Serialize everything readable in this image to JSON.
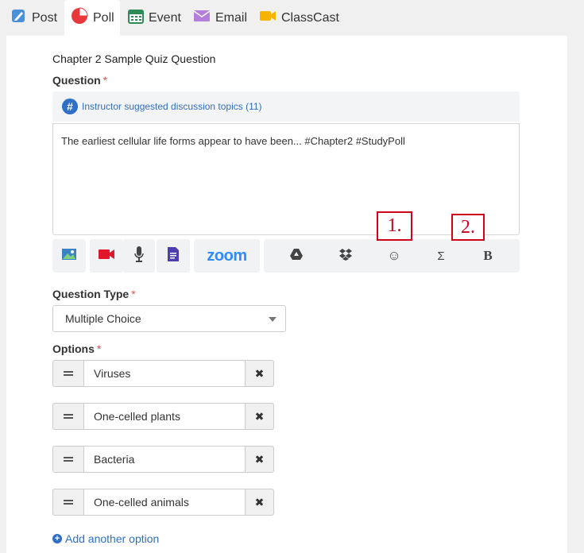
{
  "tabs": [
    {
      "label": "Post",
      "icon": "post-icon"
    },
    {
      "label": "Poll",
      "icon": "pie-chart-icon",
      "active": true
    },
    {
      "label": "Event",
      "icon": "calendar-icon"
    },
    {
      "label": "Email",
      "icon": "envelope-icon"
    },
    {
      "label": "ClassCast",
      "icon": "video-camera-icon"
    }
  ],
  "form": {
    "title_value": "Chapter 2 Sample Quiz Question",
    "question_label": "Question",
    "required_mark": "*",
    "topics_link": "Instructor suggested discussion topics (11)",
    "topics_icon_glyph": "#",
    "question_text": "The earliest cellular life forms appear to have been... #Chapter2 #StudyPoll",
    "question_type_label": "Question Type",
    "question_type_value": "Multiple Choice",
    "options_label": "Options",
    "options": [
      "Viruses",
      "One-celled plants",
      "Bacteria",
      "One-celled animals"
    ],
    "remove_glyph": "✖",
    "add_option_label": "Add another option",
    "add_icon_glyph": "+"
  },
  "toolbar": {
    "zoom_label": "zoom",
    "emoji_glyph": "☺",
    "sigma_glyph": "Σ",
    "bold_glyph": "B"
  },
  "annotations": [
    "1.",
    "2."
  ],
  "colors": {
    "link": "#2f6fc6",
    "required": "#d9534f",
    "annotation": "#d0021b",
    "zoom": "#2d8cff",
    "video": "#e0162b",
    "doc": "#4b3fae"
  }
}
